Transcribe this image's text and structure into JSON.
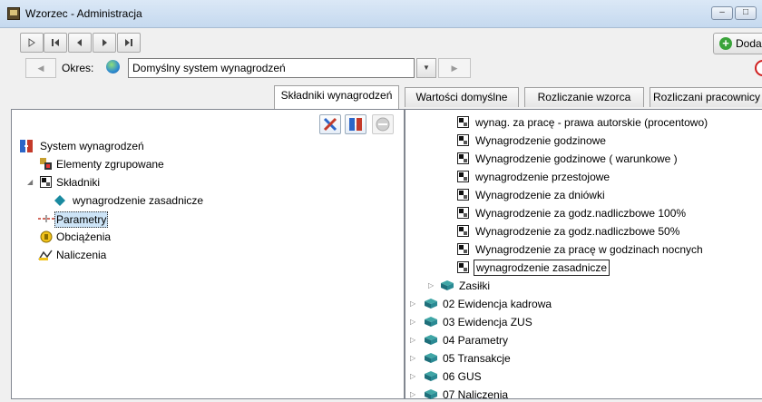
{
  "window": {
    "title": "Wzorzec - Administracja"
  },
  "toolbar": {
    "add_label": "Doda"
  },
  "okres": {
    "label": "Okres:",
    "value": "Domyślny system wynagrodzeń"
  },
  "tabs": [
    {
      "label": "Składniki wynagrodzeń",
      "active": true
    },
    {
      "label": "Wartości domyślne",
      "active": false
    },
    {
      "label": "Rozliczanie wzorca",
      "active": false
    },
    {
      "label": "Rozliczani pracownicy",
      "active": false
    }
  ],
  "left_tree": {
    "items": [
      {
        "label": "System wynagrodzeń",
        "icon": "system-icon",
        "level": 0
      },
      {
        "label": "Elementy zgrupowane",
        "icon": "group-icon",
        "level": 1
      },
      {
        "label": "Składniki",
        "icon": "document-icon",
        "level": 1,
        "expanded": true
      },
      {
        "label": "wynagrodzenie zasadnicze",
        "icon": "diamond-icon",
        "level": 2
      },
      {
        "label": "Parametry",
        "icon": "parameters-icon",
        "level": 1,
        "selected": true
      },
      {
        "label": "Obciążenia",
        "icon": "charges-icon",
        "level": 1
      },
      {
        "label": "Naliczenia",
        "icon": "accruals-icon",
        "level": 1
      }
    ]
  },
  "right_tree": {
    "items": [
      {
        "label": "wynag. za pracę - prawa autorskie (procentowo)",
        "kind": "doc"
      },
      {
        "label": "Wynagrodzenie godzinowe",
        "kind": "doc"
      },
      {
        "label": "Wynagrodzenie godzinowe ( warunkowe )",
        "kind": "doc"
      },
      {
        "label": "wynagrodzenie przestojowe",
        "kind": "doc"
      },
      {
        "label": "Wynagrodzenie za dniówki",
        "kind": "doc"
      },
      {
        "label": "Wynagrodzenie za godz.nadliczbowe 100%",
        "kind": "doc"
      },
      {
        "label": "Wynagrodzenie za godz.nadliczbowe 50%",
        "kind": "doc"
      },
      {
        "label": "Wynagrodzenie za pracę w godzinach nocnych",
        "kind": "doc"
      },
      {
        "label": "wynagrodzenie zasadnicze",
        "kind": "doc",
        "focused": true
      },
      {
        "label": "Zasiłki",
        "kind": "book-sub"
      },
      {
        "label": "02 Ewidencja kadrowa",
        "kind": "book"
      },
      {
        "label": "03 Ewidencja ZUS",
        "kind": "book"
      },
      {
        "label": "04 Parametry",
        "kind": "book"
      },
      {
        "label": "05 Transakcje",
        "kind": "book"
      },
      {
        "label": "06 GUS",
        "kind": "book"
      },
      {
        "label": "07 Naliczenia",
        "kind": "book"
      }
    ]
  }
}
